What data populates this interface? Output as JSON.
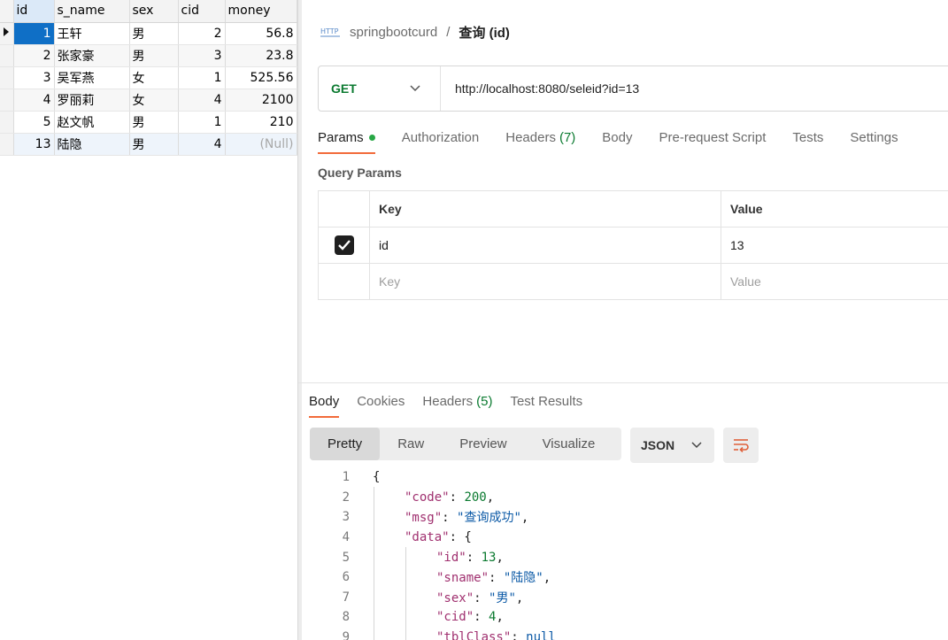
{
  "db": {
    "columns": [
      "id",
      "s_name",
      "sex",
      "cid",
      "money"
    ],
    "rows": [
      {
        "id": "1",
        "s_name": "王轩",
        "sex": "男",
        "cid": "2",
        "money": "56.8"
      },
      {
        "id": "2",
        "s_name": "张家豪",
        "sex": "男",
        "cid": "3",
        "money": "23.8"
      },
      {
        "id": "3",
        "s_name": "吴军燕",
        "sex": "女",
        "cid": "1",
        "money": "525.56"
      },
      {
        "id": "4",
        "s_name": "罗丽莉",
        "sex": "女",
        "cid": "4",
        "money": "2100"
      },
      {
        "id": "5",
        "s_name": "赵文帆",
        "sex": "男",
        "cid": "1",
        "money": "210"
      },
      {
        "id": "13",
        "s_name": "陆隐",
        "sex": "男",
        "cid": "4",
        "money": "(Null)"
      }
    ]
  },
  "postman": {
    "breadcrumb": {
      "collection": "springbootcurd",
      "separator": "/",
      "request": "查询 (id)"
    },
    "method": "GET",
    "url": "http://localhost:8080/seleid?id=13",
    "request_tabs": [
      {
        "label": "Params",
        "dot": true
      },
      {
        "label": "Authorization"
      },
      {
        "label": "Headers",
        "count": "(7)"
      },
      {
        "label": "Body"
      },
      {
        "label": "Pre-request Script"
      },
      {
        "label": "Tests"
      },
      {
        "label": "Settings"
      }
    ],
    "query_params": {
      "title": "Query Params",
      "headers": {
        "key": "Key",
        "value": "Value"
      },
      "rows": [
        {
          "key": "id",
          "value": "13",
          "checked": true
        }
      ],
      "placeholder": {
        "key": "Key",
        "value": "Value"
      }
    },
    "response_tabs": [
      {
        "label": "Body"
      },
      {
        "label": "Cookies"
      },
      {
        "label": "Headers",
        "count": "(5)"
      },
      {
        "label": "Test Results"
      }
    ],
    "view_modes": [
      "Pretty",
      "Raw",
      "Preview",
      "Visualize"
    ],
    "format": "JSON",
    "code_lines": [
      {
        "n": "1",
        "indent": 0,
        "parts": [
          [
            "p",
            "{"
          ]
        ]
      },
      {
        "n": "2",
        "indent": 1,
        "parts": [
          [
            "k",
            "\"code\""
          ],
          [
            "p",
            ": "
          ],
          [
            "n",
            "200"
          ],
          [
            "p",
            ","
          ]
        ]
      },
      {
        "n": "3",
        "indent": 1,
        "parts": [
          [
            "k",
            "\"msg\""
          ],
          [
            "p",
            ": "
          ],
          [
            "s",
            "\"查询成功\""
          ],
          [
            "p",
            ","
          ]
        ]
      },
      {
        "n": "4",
        "indent": 1,
        "parts": [
          [
            "k",
            "\"data\""
          ],
          [
            "p",
            ": {"
          ]
        ]
      },
      {
        "n": "5",
        "indent": 2,
        "parts": [
          [
            "k",
            "\"id\""
          ],
          [
            "p",
            ": "
          ],
          [
            "n",
            "13"
          ],
          [
            "p",
            ","
          ]
        ]
      },
      {
        "n": "6",
        "indent": 2,
        "parts": [
          [
            "k",
            "\"sname\""
          ],
          [
            "p",
            ": "
          ],
          [
            "s",
            "\"陆隐\""
          ],
          [
            "p",
            ","
          ]
        ]
      },
      {
        "n": "7",
        "indent": 2,
        "parts": [
          [
            "k",
            "\"sex\""
          ],
          [
            "p",
            ": "
          ],
          [
            "s",
            "\"男\""
          ],
          [
            "p",
            ","
          ]
        ]
      },
      {
        "n": "8",
        "indent": 2,
        "parts": [
          [
            "k",
            "\"cid\""
          ],
          [
            "p",
            ": "
          ],
          [
            "n",
            "4"
          ],
          [
            "p",
            ","
          ]
        ]
      },
      {
        "n": "9",
        "indent": 2,
        "parts": [
          [
            "k",
            "\"tblClass\""
          ],
          [
            "p",
            ": "
          ],
          [
            "nl",
            "null"
          ]
        ]
      }
    ]
  },
  "colors": {
    "method_get": "#0b7a30",
    "tab_active_underline": "#f26b3a",
    "selection": "#0f6fc6",
    "params_dot": "#28a745"
  }
}
